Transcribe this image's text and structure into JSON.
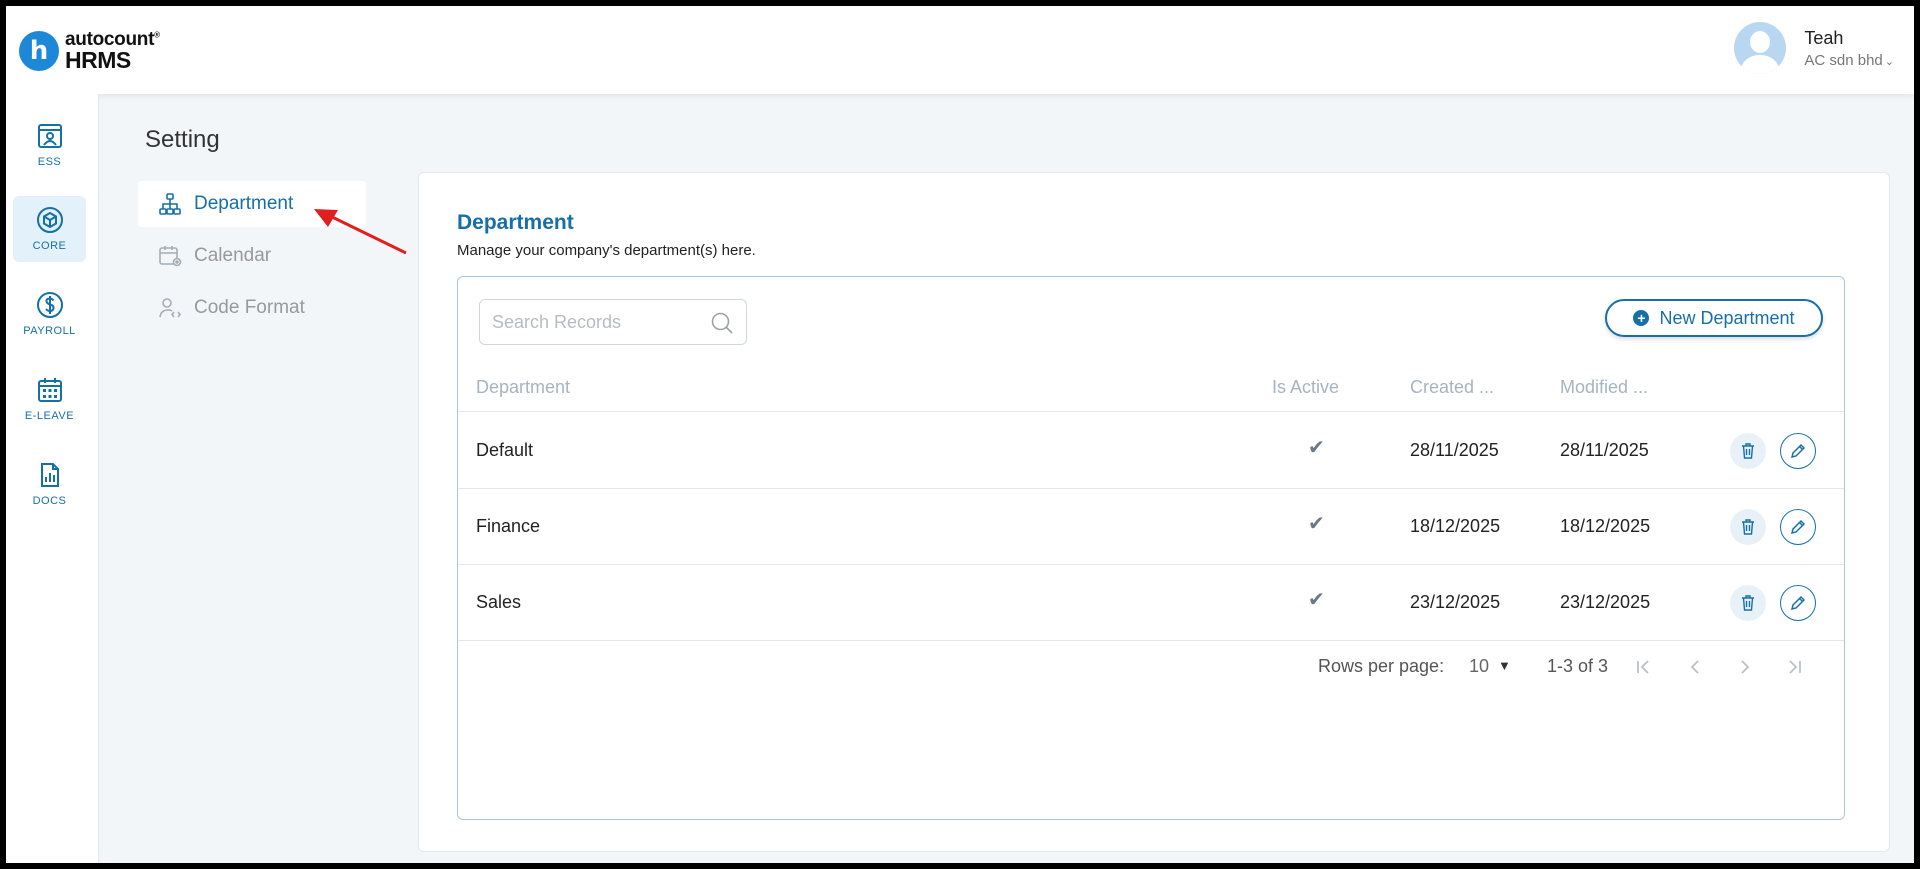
{
  "app": {
    "logo_letter": "h",
    "logo_brand": "autocount",
    "logo_mark": "®",
    "logo_product": "HRMS"
  },
  "user": {
    "name": "Teah",
    "company": "AC sdn bhd"
  },
  "rail": {
    "items": [
      {
        "label": "ESS",
        "icon": "ess-icon"
      },
      {
        "label": "CORE",
        "icon": "core-icon",
        "active": true
      },
      {
        "label": "PAYROLL",
        "icon": "payroll-icon"
      },
      {
        "label": "E-LEAVE",
        "icon": "calendar-icon"
      },
      {
        "label": "DOCS",
        "icon": "docs-icon"
      }
    ]
  },
  "page": {
    "title": "Setting"
  },
  "settings_nav": {
    "items": [
      {
        "label": "Department",
        "icon": "org-chart-icon",
        "active": true
      },
      {
        "label": "Calendar",
        "icon": "calendar-gear-icon"
      },
      {
        "label": "Code Format",
        "icon": "user-code-icon"
      }
    ]
  },
  "section": {
    "title": "Department",
    "subtitle": "Manage your company's department(s) here."
  },
  "toolbar": {
    "search_placeholder": "Search Records",
    "new_button_label": "New Department"
  },
  "table": {
    "columns": [
      "Department",
      "Is Active",
      "Created ...",
      "Modified ..."
    ],
    "rows": [
      {
        "department": "Default",
        "active": "✔",
        "created": "28/11/2025",
        "modified": "28/11/2025"
      },
      {
        "department": "Finance",
        "active": "✔",
        "created": "18/12/2025",
        "modified": "18/12/2025"
      },
      {
        "department": "Sales",
        "active": "✔",
        "created": "23/12/2025",
        "modified": "23/12/2025"
      }
    ]
  },
  "pagination": {
    "rows_per_page_label": "Rows per page:",
    "rows_per_page_value": "10",
    "range": "1-3 of 3"
  },
  "colors": {
    "accent": "#1670a8",
    "annotation_arrow": "#e02020"
  }
}
